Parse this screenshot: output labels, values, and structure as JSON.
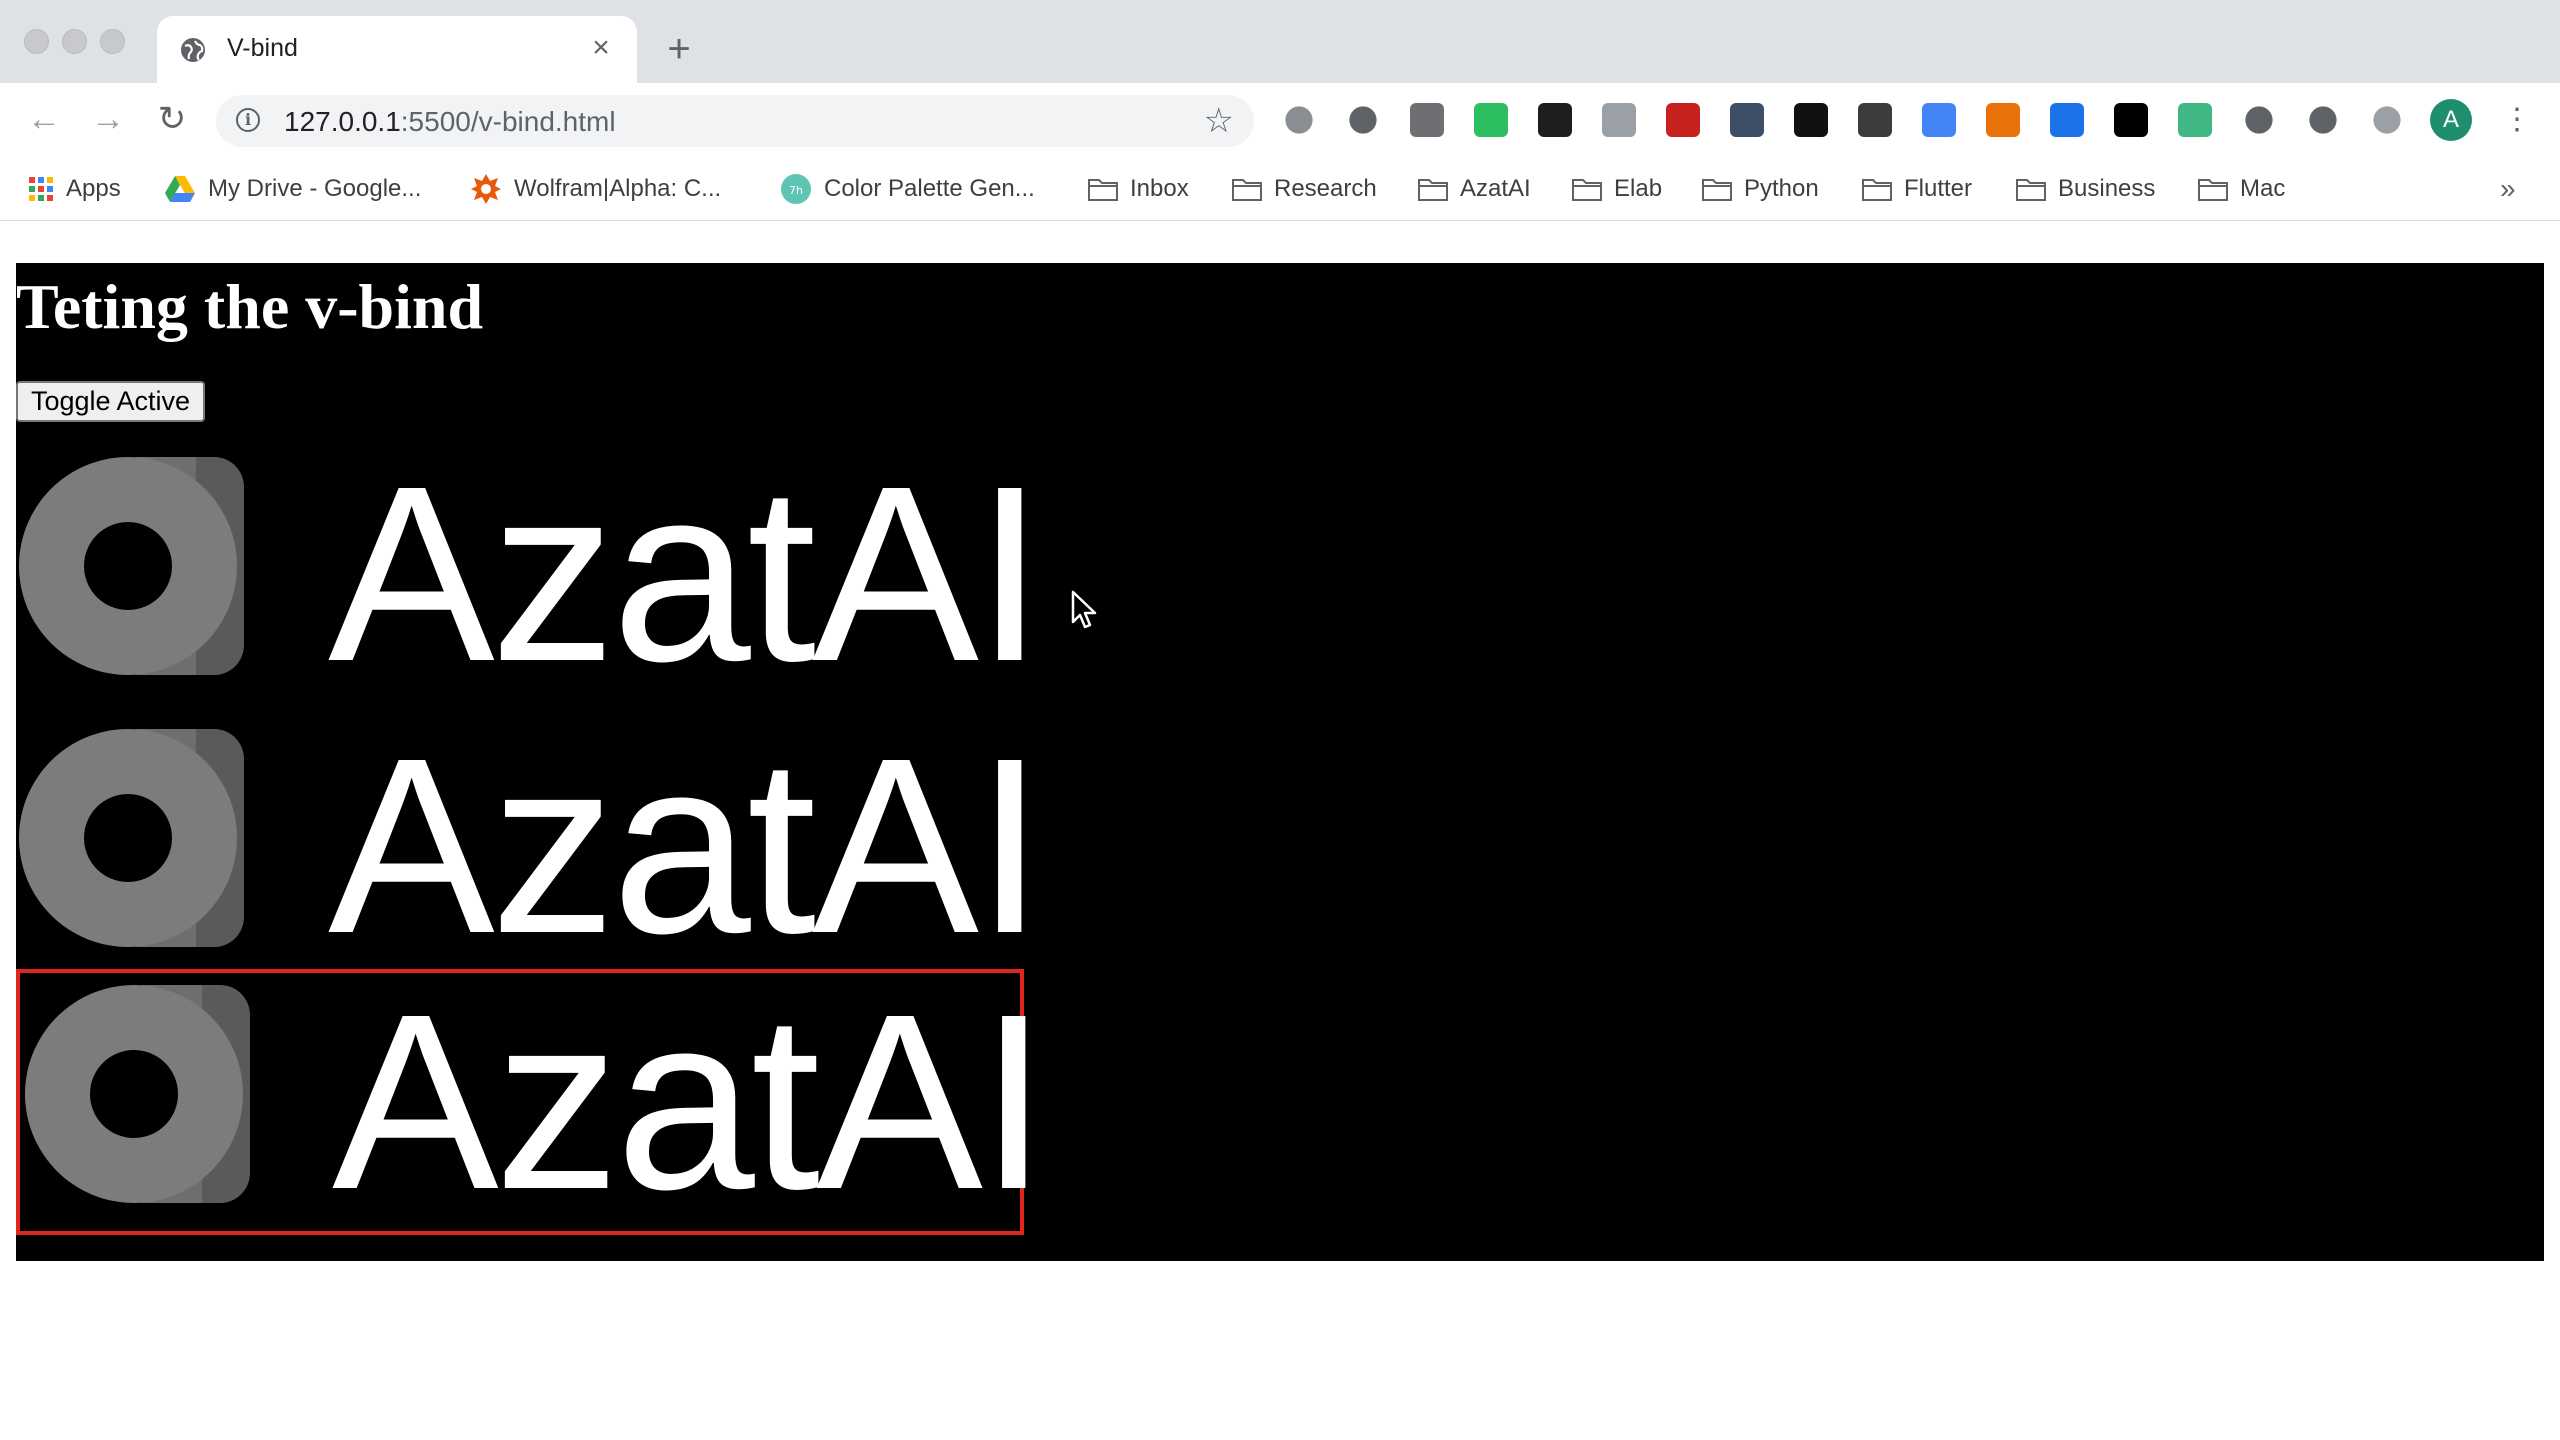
{
  "browser": {
    "tab": {
      "title": "V-bind",
      "close_glyph": "×"
    },
    "new_tab_glyph": "+",
    "nav": {
      "back_glyph": "←",
      "forward_glyph": "→",
      "reload_glyph": "↻"
    },
    "url": {
      "host": "127.0.0.1",
      "path": ":5500/v-bind.html"
    },
    "profile_initial": "A",
    "menu_glyph": "⋮",
    "star_glyph": "☆",
    "info_glyph": "i",
    "extensions": [
      {
        "name": "settings-gear-extension-icon",
        "color": "#8a8d91"
      },
      {
        "name": "pocket-extension-icon",
        "color": "#5f6368"
      },
      {
        "name": "hypothesis-extension-icon",
        "color": "#6d6f73"
      },
      {
        "name": "evernote-extension-icon",
        "color": "#2dbe60"
      },
      {
        "name": "tampermonkey-extension-icon",
        "color": "#1e1e1e"
      },
      {
        "name": "download-extension-icon",
        "color": "#9aa0a6"
      },
      {
        "name": "book-extension-icon",
        "color": "#c5221f"
      },
      {
        "name": "off-badge-extension-icon",
        "color": "#3d4e66"
      },
      {
        "name": "notion-extension-icon",
        "color": "#111111"
      },
      {
        "name": "cube-extension-icon",
        "color": "#3c3c3c"
      },
      {
        "name": "google-translate-extension-icon",
        "color": "#4285f4"
      },
      {
        "name": "toggle-extension-icon",
        "color": "#e8710a"
      },
      {
        "name": "onepassword-extension-icon",
        "color": "#1a73e8"
      },
      {
        "name": "jetbrains-extension-icon",
        "color": "#000000"
      },
      {
        "name": "vue-devtools-extension-icon",
        "color": "#41b883"
      },
      {
        "name": "mouse-extension-icon",
        "color": "#5f6368"
      },
      {
        "name": "puzzle-extensions-icon",
        "color": "#5f6368"
      },
      {
        "name": "media-queue-icon",
        "color": "#9aa0a6"
      }
    ]
  },
  "bookmarks": {
    "items": [
      {
        "label": "Apps",
        "icon": "apps-grid-icon"
      },
      {
        "label": "My Drive - Google...",
        "icon": "google-drive-icon"
      },
      {
        "label": "Wolfram|Alpha: C...",
        "icon": "wolfram-icon"
      },
      {
        "label": "Color Palette Gen...",
        "icon": "color-palette-icon"
      },
      {
        "label": "Inbox",
        "icon": "folder-icon"
      },
      {
        "label": "Research",
        "icon": "folder-icon"
      },
      {
        "label": "AzatAI",
        "icon": "folder-icon"
      },
      {
        "label": "Elab",
        "icon": "folder-icon"
      },
      {
        "label": "Python",
        "icon": "folder-icon"
      },
      {
        "label": "Flutter",
        "icon": "folder-icon"
      },
      {
        "label": "Business",
        "icon": "folder-icon"
      },
      {
        "label": "Mac",
        "icon": "folder-icon"
      }
    ],
    "more_glyph": "»"
  },
  "page": {
    "title": "Teting the v-bind",
    "toggle_button": "Toggle Active",
    "items": [
      {
        "brand": "AzatAI",
        "active": false
      },
      {
        "brand": "AzatAI",
        "active": false
      },
      {
        "brand": "AzatAI",
        "active": true
      }
    ],
    "active_border_color": "#e0261b"
  }
}
